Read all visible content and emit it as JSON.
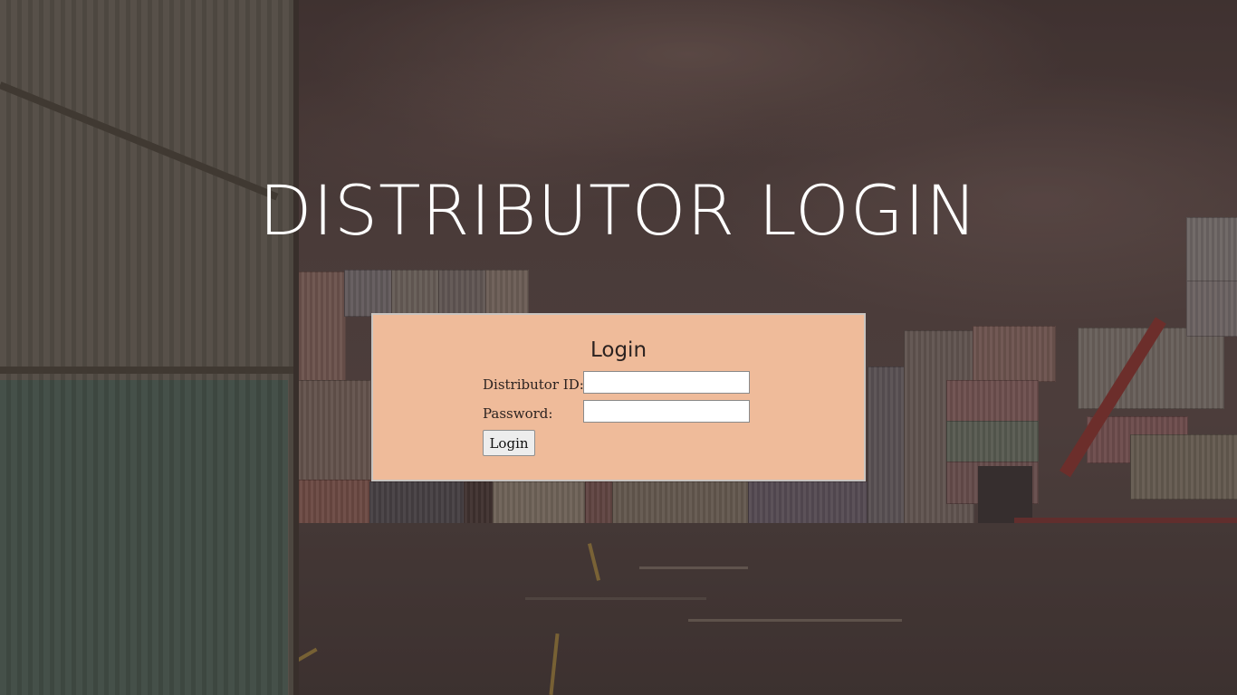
{
  "page": {
    "heading": "DISTRIBUTOR LOGIN"
  },
  "login_form": {
    "title": "Login",
    "distributor_id_label": "Distributor ID:",
    "distributor_id_value": "",
    "password_label": "Password:",
    "password_value": "",
    "submit_label": "Login"
  },
  "colors": {
    "panel_background": "#efbb9a",
    "heading_text": "#ffffff"
  }
}
